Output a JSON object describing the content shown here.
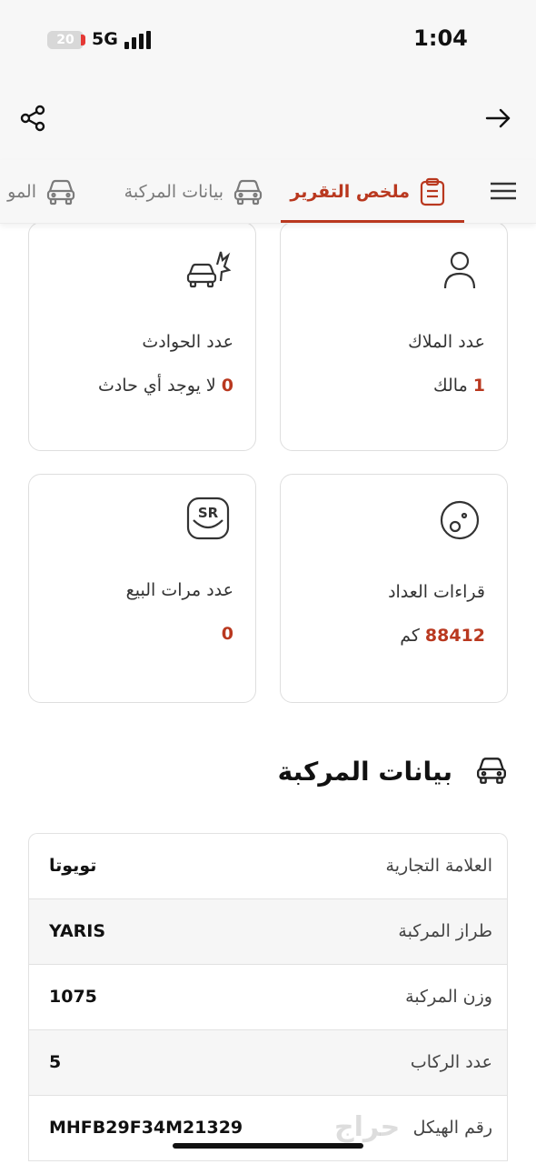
{
  "status_bar": {
    "battery_level": "20",
    "battery_fraction": 0.2,
    "network": "5G",
    "time": "1:04"
  },
  "app_bar": {
    "share_icon": "share-icon",
    "back_icon": "arrow-right-icon"
  },
  "tabs": [
    {
      "label": "ملخص التقرير",
      "icon": "clipboard-icon",
      "active": true
    },
    {
      "label": "بيانات المركبة",
      "icon": "car-icon",
      "active": false
    },
    {
      "label": "المو",
      "icon": "car-icon",
      "active": false
    }
  ],
  "menu_icon": "hamburger-menu-icon",
  "summary_cards": {
    "owners": {
      "label": "عدد الملاك",
      "number": "1",
      "unit": "مالك",
      "icon": "person-icon"
    },
    "accidents": {
      "label": "عدد الحوادث",
      "number": "0",
      "unit": "لا يوجد أي حادث",
      "icon": "car-crash-icon"
    },
    "odometer": {
      "label": "قراءات العداد",
      "number": "88412",
      "unit": "كم",
      "icon": "odometer-icon"
    },
    "sales": {
      "label": "عدد مرات البيع",
      "number": "0",
      "unit": "",
      "icon": "sr-badge-icon",
      "badge_text": "SR"
    }
  },
  "vehicle_section": {
    "title": "بيانات المركبة",
    "rows": [
      {
        "label": "العلامة التجارية",
        "value": "تويوتا"
      },
      {
        "label": "طراز المركبة",
        "value": "YARIS"
      },
      {
        "label": "وزن المركبة",
        "value": "1075"
      },
      {
        "label": "عدد الركاب",
        "value": "5"
      },
      {
        "label": "رقم الهيكل",
        "value": "MHFB29F34M21329"
      }
    ]
  },
  "accent_color": "#b9381f",
  "watermark": "حراج"
}
